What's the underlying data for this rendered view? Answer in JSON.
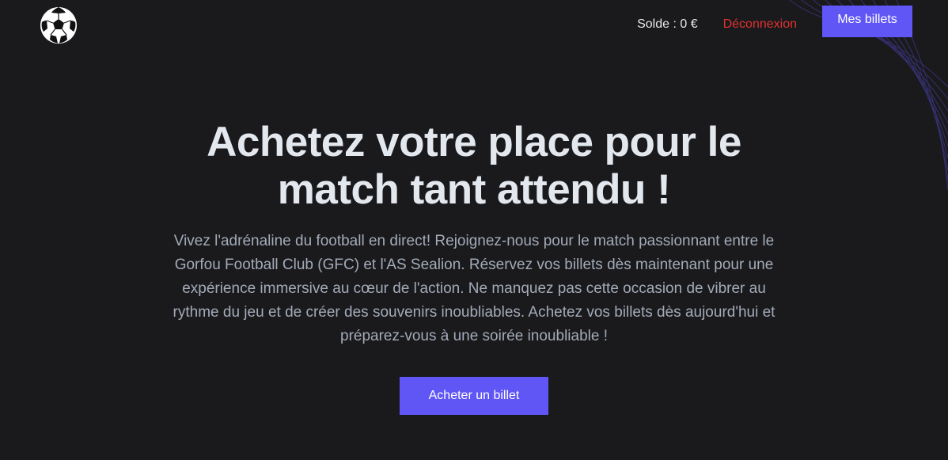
{
  "header": {
    "logo_icon": "soccer-ball-icon",
    "balance_label": "Solde : 0 €",
    "logout_label": "Déconnexion",
    "my_tickets_label": "Mes billets"
  },
  "hero": {
    "title": "Achetez votre place pour le match tant attendu !",
    "description": "Vivez l'adrénaline du football en direct! Rejoignez-nous pour le match passionnant entre le Gorfou Football Club (GFC) et l'AS Sealion. Réservez vos billets dès maintenant pour une expérience immersive au cœur de l'action. Ne manquez pas cette occasion de vibrer au rythme du jeu et de créer des souvenirs inoubliables. Achetez vos billets dès aujourd'hui et préparez-vous à une soirée inoubliable !",
    "buy_button_label": "Acheter un billet"
  },
  "colors": {
    "background": "#1a1a1d",
    "accent": "#6056f5",
    "logout": "#e0322f",
    "title": "#e3e8ef",
    "text": "#a3abb8"
  }
}
